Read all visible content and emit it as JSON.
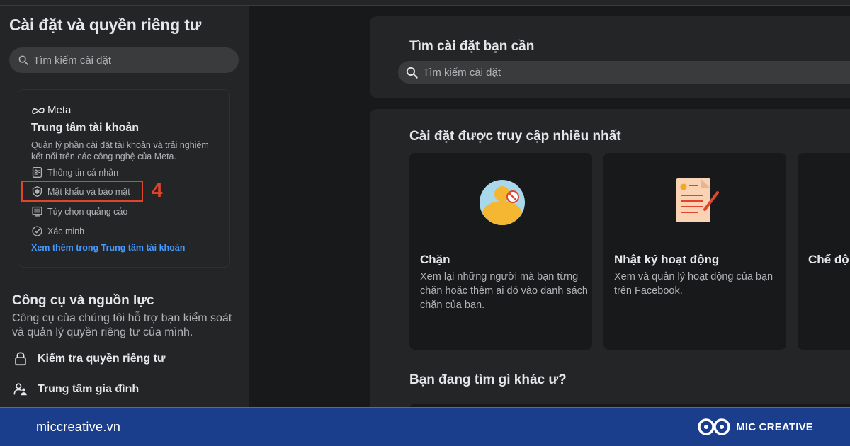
{
  "sidebar": {
    "title": "Cài đặt và quyền riêng tư",
    "search_placeholder": "Tìm kiếm cài đặt",
    "meta_card": {
      "logo_text": "Meta",
      "title": "Trung tâm tài khoản",
      "description": "Quản lý phần cài đặt tài khoản và trải nghiệm kết nối trên các công nghệ của Meta.",
      "items": [
        {
          "label": "Thông tin cá nhân",
          "icon": "id-card-icon"
        },
        {
          "label": "Mật khẩu và bảo mật",
          "icon": "shield-icon"
        },
        {
          "label": "Tùy chọn quảng cáo",
          "icon": "monitor-icon"
        },
        {
          "label": "Xác minh",
          "icon": "verified-icon"
        }
      ],
      "link": "Xem thêm trong Trung tâm tài khoản"
    },
    "annotation_number": "4",
    "tools": {
      "title": "Công cụ và nguồn lực",
      "description": "Công cụ của chúng tôi hỗ trợ bạn kiểm soát và quản lý quyền riêng tư của mình.",
      "items": [
        {
          "label": "Kiểm tra quyền riêng tư",
          "icon": "lock-icon"
        },
        {
          "label": "Trung tâm gia đình",
          "icon": "family-icon"
        }
      ]
    }
  },
  "main": {
    "search_card": {
      "title": "Tìm cài đặt bạn cần",
      "search_placeholder": "Tìm kiếm cài đặt"
    },
    "most_visited": {
      "title": "Cài đặt được truy cập nhiều nhất",
      "tiles": [
        {
          "title": "Chặn",
          "description": "Xem lại những người mà bạn từng chặn hoặc thêm ai đó vào danh sách chặn của bạn.",
          "icon": "blocked-user-icon"
        },
        {
          "title": "Nhật ký hoạt động",
          "description": "Xem và quản lý hoạt động của bạn trên Facebook.",
          "icon": "activity-log-icon"
        },
        {
          "title": "Chế độ",
          "description": "",
          "icon": ""
        }
      ],
      "other_title": "Bạn đang tìm gì khác ư?"
    }
  },
  "footer": {
    "site": "miccreative.vn",
    "brand": "MIC CREATIVE"
  },
  "colors": {
    "background": "#18191a",
    "card": "#242526",
    "highlight": "#e0452a",
    "link": "#4599ff",
    "footer": "#1b3e8c"
  }
}
